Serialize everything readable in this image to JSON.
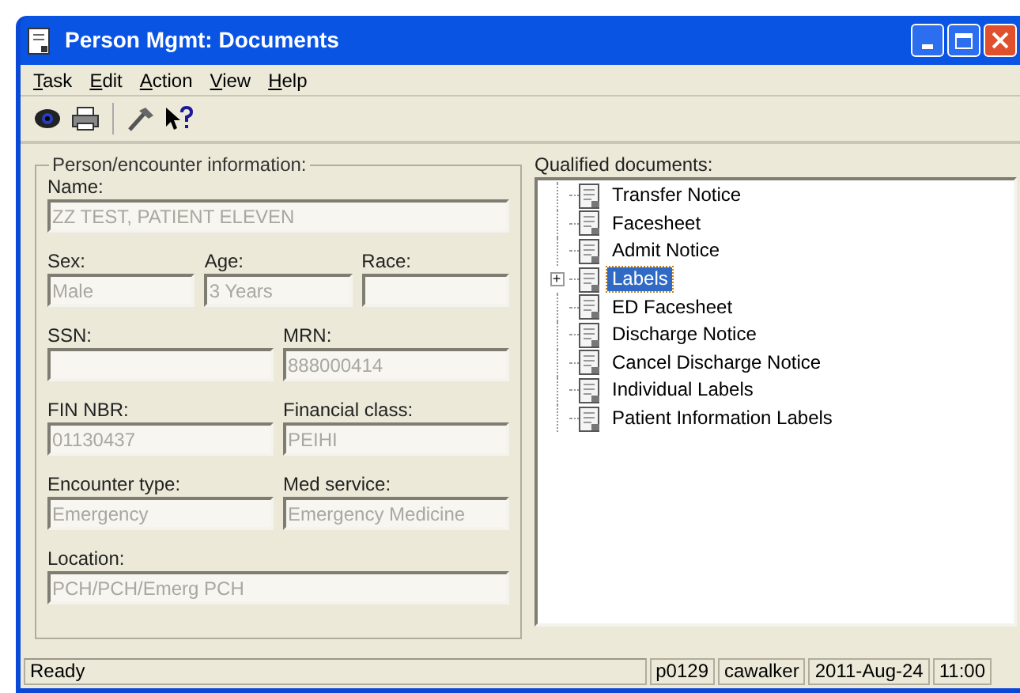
{
  "window": {
    "title": "Person Mgmt: Documents"
  },
  "menu": [
    {
      "label": "Task"
    },
    {
      "label": "Edit"
    },
    {
      "label": "Action"
    },
    {
      "label": "View"
    },
    {
      "label": "Help"
    }
  ],
  "person_group": {
    "title": "Person/encounter information:",
    "rows": [
      [
        {
          "label": "Name:",
          "value": "ZZ TEST, PATIENT ELEVEN",
          "disabled": true
        }
      ],
      [
        {
          "label": "Sex:",
          "value": "Male",
          "disabled": true
        },
        {
          "label": "Age:",
          "value": "3 Years",
          "disabled": true
        },
        {
          "label": "Race:",
          "disabled": true
        }
      ],
      [
        {
          "label": "SSN:",
          "disabled": true
        },
        {
          "label": "MRN:",
          "value": "888000414",
          "disabled": true
        }
      ],
      [
        {
          "label": "FIN NBR:",
          "value": "01130437",
          "disabled": true
        },
        {
          "label": "Financial class:",
          "value": "PEIHI",
          "disabled": true
        }
      ],
      [
        {
          "label": "Encounter type:",
          "value": "Emergency",
          "disabled": true
        },
        {
          "label": "Med service:",
          "value": "Emergency Medicine",
          "disabled": true
        }
      ],
      [
        {
          "label": "Location:",
          "value": "PCH/PCH/Emerg PCH",
          "disabled": true
        }
      ]
    ]
  },
  "documents": {
    "title": "Qualified documents:",
    "items": [
      {
        "label": "Transfer Notice",
        "selected": false
      },
      {
        "label": "Facesheet",
        "selected": false
      },
      {
        "label": "Admit Notice",
        "selected": false
      },
      {
        "label": "Labels",
        "selected": true,
        "expander": "+"
      },
      {
        "label": "ED Facesheet",
        "selected": false
      },
      {
        "label": "Discharge Notice",
        "selected": false
      },
      {
        "label": "Cancel Discharge Notice",
        "selected": false
      },
      {
        "label": "Individual Labels",
        "selected": false
      },
      {
        "label": "Patient Information Labels",
        "selected": false
      }
    ]
  },
  "status_bar": {
    "message": "Ready",
    "panes": [
      "p0129",
      "cawalker",
      "2011-Aug-24",
      "11:00"
    ]
  }
}
